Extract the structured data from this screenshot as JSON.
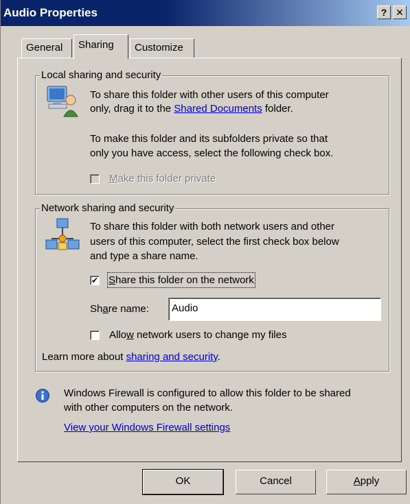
{
  "window": {
    "title": "Audio Properties"
  },
  "titlebar": {
    "help_label": "?",
    "close_label": "✕"
  },
  "tabs": [
    {
      "label": "General"
    },
    {
      "label": "Sharing"
    },
    {
      "label": "Customize"
    }
  ],
  "local": {
    "legend": "Local sharing and security",
    "line1": "To share this folder with other users of this computer",
    "line2_pre": "only, drag it to the ",
    "line2_link": "Shared Documents",
    "line2_post": " folder.",
    "line3": "To make this folder and its subfolders private so that",
    "line4": "only you have access, select the following check box.",
    "private_label_acc": "M",
    "private_label_rest": "ake this folder private",
    "private_checked": false,
    "icon": "computer-user-icon"
  },
  "network": {
    "legend": "Network sharing and security",
    "line1": "To share this folder with both network users and other",
    "line2": "users of this computer, select the first check box below",
    "line3": "and type a share name.",
    "share_label_acc": "S",
    "share_label_rest": "hare this folder on the network",
    "share_checked": true,
    "share_name_label_pre": "Sh",
    "share_name_label_acc": "a",
    "share_name_label_post": "re name:",
    "share_name_value": "Audio",
    "allow_label_pre": "Allo",
    "allow_label_acc": "w",
    "allow_label_post": " network users to change my files",
    "allow_checked": false,
    "learn_pre": "Learn more about ",
    "learn_link": "sharing and security",
    "learn_post": ".",
    "icon": "network-users-icon"
  },
  "firewall": {
    "line1": "Windows Firewall is configured to allow this folder to be shared",
    "line2": "with other computers on the network.",
    "link": "View your Windows Firewall settings",
    "icon": "info-icon"
  },
  "buttons": {
    "ok": "OK",
    "cancel": "Cancel",
    "apply_acc": "A",
    "apply_rest": "pply"
  },
  "colors": {
    "face": "#d4d0c8",
    "title_bar": "#0a246a",
    "link": "#0000cc"
  }
}
